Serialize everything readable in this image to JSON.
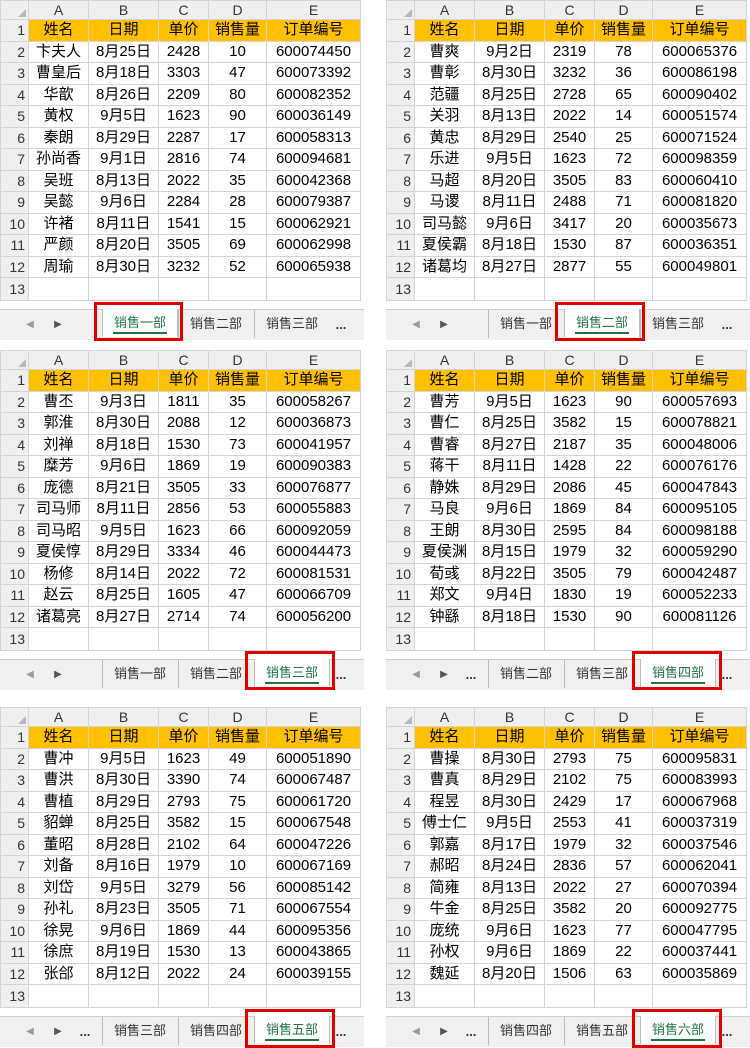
{
  "columns": [
    "A",
    "B",
    "C",
    "D",
    "E"
  ],
  "header": [
    "姓名",
    "日期",
    "单价",
    "销售量",
    "订单编号"
  ],
  "row_numbers": [
    "1",
    "2",
    "3",
    "4",
    "5",
    "6",
    "7",
    "8",
    "9",
    "10",
    "11",
    "12",
    "13"
  ],
  "accent_color": "#ffc000",
  "highlight_color": "#e00000",
  "panels": [
    {
      "rows": [
        [
          "卞夫人",
          "8月25日",
          "2428",
          "10",
          "600074450"
        ],
        [
          "曹皇后",
          "8月18日",
          "3303",
          "47",
          "600073392"
        ],
        [
          "华歆",
          "8月26日",
          "2209",
          "80",
          "600082352"
        ],
        [
          "黄权",
          "9月5日",
          "1623",
          "90",
          "600036149"
        ],
        [
          "秦朗",
          "8月29日",
          "2287",
          "17",
          "600058313"
        ],
        [
          "孙尚香",
          "9月1日",
          "2816",
          "74",
          "600094681"
        ],
        [
          "吴班",
          "8月13日",
          "2022",
          "35",
          "600042368"
        ],
        [
          "吴懿",
          "9月6日",
          "2284",
          "28",
          "600079387"
        ],
        [
          "许褚",
          "8月11日",
          "1541",
          "15",
          "600062921"
        ],
        [
          "严颜",
          "8月20日",
          "3505",
          "69",
          "600062998"
        ],
        [
          "周瑜",
          "8月30日",
          "3232",
          "52",
          "600065938"
        ]
      ],
      "tabs": [
        "销售一部",
        "销售二部",
        "销售三部"
      ],
      "active_tab": "销售一部"
    },
    {
      "rows": [
        [
          "曹爽",
          "9月2日",
          "2319",
          "78",
          "600065376"
        ],
        [
          "曹彰",
          "8月30日",
          "3232",
          "36",
          "600086198"
        ],
        [
          "范疆",
          "8月25日",
          "2728",
          "65",
          "600090402"
        ],
        [
          "关羽",
          "8月13日",
          "2022",
          "14",
          "600051574"
        ],
        [
          "黄忠",
          "8月29日",
          "2540",
          "25",
          "600071524"
        ],
        [
          "乐进",
          "9月5日",
          "1623",
          "72",
          "600098359"
        ],
        [
          "马超",
          "8月20日",
          "3505",
          "83",
          "600060410"
        ],
        [
          "马谡",
          "8月11日",
          "2488",
          "71",
          "600081820"
        ],
        [
          "司马懿",
          "9月6日",
          "3417",
          "20",
          "600035673"
        ],
        [
          "夏侯霸",
          "8月18日",
          "1530",
          "87",
          "600036351"
        ],
        [
          "诸葛均",
          "8月27日",
          "2877",
          "55",
          "600049801"
        ]
      ],
      "tabs": [
        "销售一部",
        "销售二部",
        "销售三部"
      ],
      "active_tab": "销售二部"
    },
    {
      "rows": [
        [
          "曹丕",
          "9月3日",
          "1811",
          "35",
          "600058267"
        ],
        [
          "郭淮",
          "8月30日",
          "2088",
          "12",
          "600036873"
        ],
        [
          "刘禅",
          "8月18日",
          "1530",
          "73",
          "600041957"
        ],
        [
          "糜芳",
          "9月6日",
          "1869",
          "19",
          "600090383"
        ],
        [
          "庞德",
          "8月21日",
          "3505",
          "33",
          "600076877"
        ],
        [
          "司马师",
          "8月11日",
          "2856",
          "53",
          "600055883"
        ],
        [
          "司马昭",
          "9月5日",
          "1623",
          "66",
          "600092059"
        ],
        [
          "夏侯惇",
          "8月29日",
          "3334",
          "46",
          "600044473"
        ],
        [
          "杨修",
          "8月14日",
          "2022",
          "72",
          "600081531"
        ],
        [
          "赵云",
          "8月25日",
          "1605",
          "47",
          "600066709"
        ],
        [
          "诸葛亮",
          "8月27日",
          "2714",
          "74",
          "600056200"
        ]
      ],
      "tabs": [
        "销售一部",
        "销售二部",
        "销售三部"
      ],
      "active_tab": "销售三部"
    },
    {
      "rows": [
        [
          "曹芳",
          "9月5日",
          "1623",
          "90",
          "600057693"
        ],
        [
          "曹仁",
          "8月25日",
          "3582",
          "15",
          "600078821"
        ],
        [
          "曹睿",
          "8月27日",
          "2187",
          "35",
          "600048006"
        ],
        [
          "蒋干",
          "8月11日",
          "1428",
          "22",
          "600076176"
        ],
        [
          "静姝",
          "8月29日",
          "2086",
          "45",
          "600047843"
        ],
        [
          "马良",
          "9月6日",
          "1869",
          "84",
          "600095105"
        ],
        [
          "王朗",
          "8月30日",
          "2595",
          "84",
          "600098188"
        ],
        [
          "夏侯渊",
          "8月15日",
          "1979",
          "32",
          "600059290"
        ],
        [
          "荀彧",
          "8月22日",
          "3505",
          "79",
          "600042487"
        ],
        [
          "郑文",
          "9月4日",
          "1830",
          "19",
          "600052233"
        ],
        [
          "钟繇",
          "8月18日",
          "1530",
          "90",
          "600081126"
        ]
      ],
      "tabs": [
        "销售二部",
        "销售三部",
        "销售四部"
      ],
      "active_tab": "销售四部"
    },
    {
      "rows": [
        [
          "曹冲",
          "9月5日",
          "1623",
          "49",
          "600051890"
        ],
        [
          "曹洪",
          "8月30日",
          "3390",
          "74",
          "600067487"
        ],
        [
          "曹植",
          "8月29日",
          "2793",
          "75",
          "600061720"
        ],
        [
          "貂蝉",
          "8月25日",
          "3582",
          "15",
          "600067548"
        ],
        [
          "董昭",
          "8月28日",
          "2102",
          "64",
          "600047226"
        ],
        [
          "刘备",
          "8月16日",
          "1979",
          "10",
          "600067169"
        ],
        [
          "刘岱",
          "9月5日",
          "3279",
          "56",
          "600085142"
        ],
        [
          "孙礼",
          "8月23日",
          "3505",
          "71",
          "600067554"
        ],
        [
          "徐晃",
          "9月6日",
          "1869",
          "44",
          "600095356"
        ],
        [
          "徐庶",
          "8月19日",
          "1530",
          "13",
          "600043865"
        ],
        [
          "张郃",
          "8月12日",
          "2022",
          "24",
          "600039155"
        ]
      ],
      "tabs": [
        "销售三部",
        "销售四部",
        "销售五部"
      ],
      "active_tab": "销售五部"
    },
    {
      "rows": [
        [
          "曹操",
          "8月30日",
          "2793",
          "75",
          "600095831"
        ],
        [
          "曹真",
          "8月29日",
          "2102",
          "75",
          "600083993"
        ],
        [
          "程昱",
          "8月30日",
          "2429",
          "17",
          "600067968"
        ],
        [
          "傅士仁",
          "9月5日",
          "2553",
          "41",
          "600037319"
        ],
        [
          "郭嘉",
          "8月17日",
          "1979",
          "32",
          "600037546"
        ],
        [
          "郝昭",
          "8月24日",
          "2836",
          "57",
          "600062041"
        ],
        [
          "简雍",
          "8月13日",
          "2022",
          "27",
          "600070394"
        ],
        [
          "牛金",
          "8月25日",
          "3582",
          "20",
          "600092775"
        ],
        [
          "庞统",
          "9月6日",
          "1623",
          "77",
          "600047795"
        ],
        [
          "孙权",
          "9月6日",
          "1869",
          "22",
          "600037441"
        ],
        [
          "魏延",
          "8月20日",
          "1506",
          "63",
          "600035869"
        ]
      ],
      "tabs": [
        "销售四部",
        "销售五部",
        "销售六部"
      ],
      "active_tab": "销售六部"
    }
  ],
  "tabbar": {
    "ellipsis": "...",
    "prev": "◀",
    "next": "▶"
  }
}
